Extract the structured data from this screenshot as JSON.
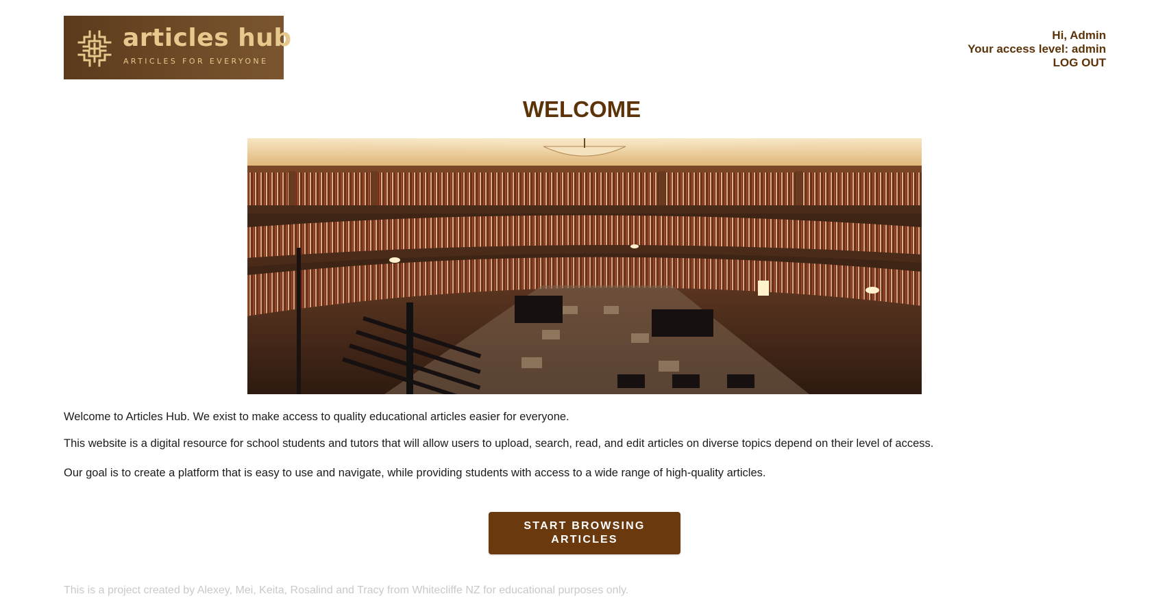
{
  "logo": {
    "title": "articles hub",
    "tagline": "ARTICLES FOR EVERYONE"
  },
  "account": {
    "greeting": "Hi, Admin",
    "access_level": "Your access level: admin",
    "logout_label": "LOG OUT"
  },
  "page": {
    "title": "WELCOME"
  },
  "intro": {
    "p1": "Welcome to Articles Hub. We exist to make access to quality educational articles easier for everyone.",
    "p2": "This website is a digital resource for school students and tutors that will allow users to upload, search, read, and edit articles on diverse topics depend on their level of access.",
    "p3": "Our goal is to create a platform that is easy to use and navigate, while providing students with access to a wide range of high-quality articles."
  },
  "cta": {
    "label": "START BROWSING ARTICLES"
  },
  "footer": {
    "text": "This is a project created by Alexey, Mei, Keita, Rosalind and Tracy from Whitecliffe NZ for educational purposes only."
  },
  "colors": {
    "brand_brown": "#5c3309",
    "button_bg": "#6a3a0e",
    "logo_gold": "#e7c98e",
    "footer_text": "#c9c9c9"
  },
  "icons": [
    "maze-logo-icon"
  ]
}
